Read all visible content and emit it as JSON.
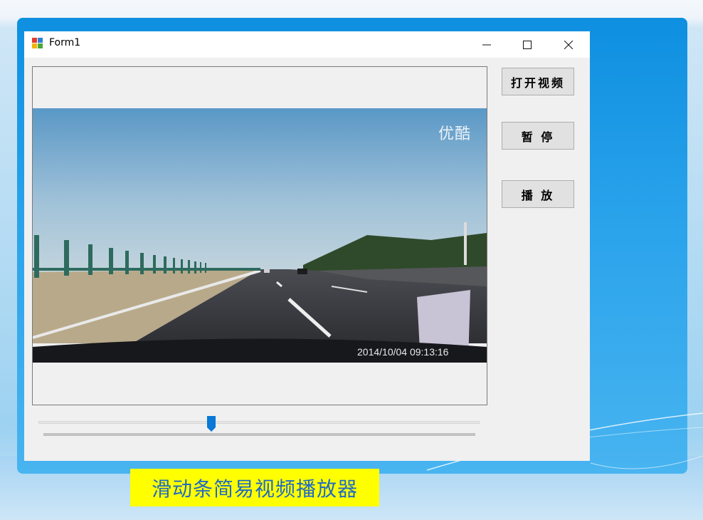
{
  "window": {
    "title": "Form1",
    "controls": {
      "minimize": "minimize-icon",
      "maximize": "maximize-icon",
      "close": "close-icon"
    }
  },
  "video": {
    "watermark": "优酷",
    "timestamp": "2014/10/04 09:13:16"
  },
  "buttons": {
    "open_video": "打开视频",
    "pause": "暂 停",
    "play": "播 放"
  },
  "slider": {
    "position_fraction": 0.39
  },
  "caption": {
    "text": "滑动条简易视频播放器",
    "background": "#ffff00",
    "color": "#1f6bc4"
  },
  "colors": {
    "slide_blue": "#0e8fe0",
    "thumb_blue": "#0a78d7"
  }
}
